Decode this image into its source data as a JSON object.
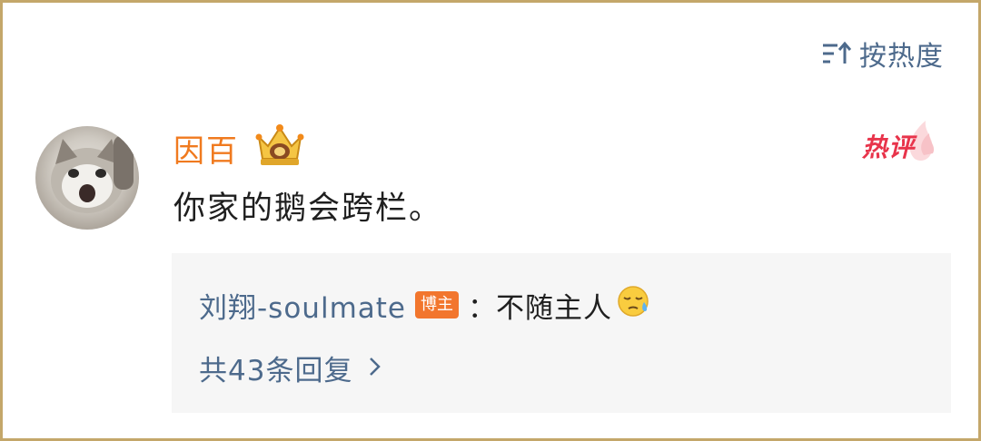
{
  "sort": {
    "icon": "sort-icon",
    "label": "按热度"
  },
  "comment": {
    "avatar_icon": "avatar-cat-photo",
    "username": "因百",
    "badge_icon": "crown-icon",
    "hot_label": "热评",
    "text": "你家的鹅会跨栏。"
  },
  "reply": {
    "author": "刘翔-soulmate",
    "author_badge": "博主",
    "colon": "：",
    "text": "不随主人",
    "emoji_icon": "sweat-face-emoji",
    "count_label": "共43条回复",
    "chevron_icon": "chevron-right-icon"
  },
  "colors": {
    "link": "#4d6a8c",
    "username": "#f07a1f",
    "hot": "#e8344b",
    "blogger_badge": "#f2762d",
    "frame": "#c4a76a"
  }
}
